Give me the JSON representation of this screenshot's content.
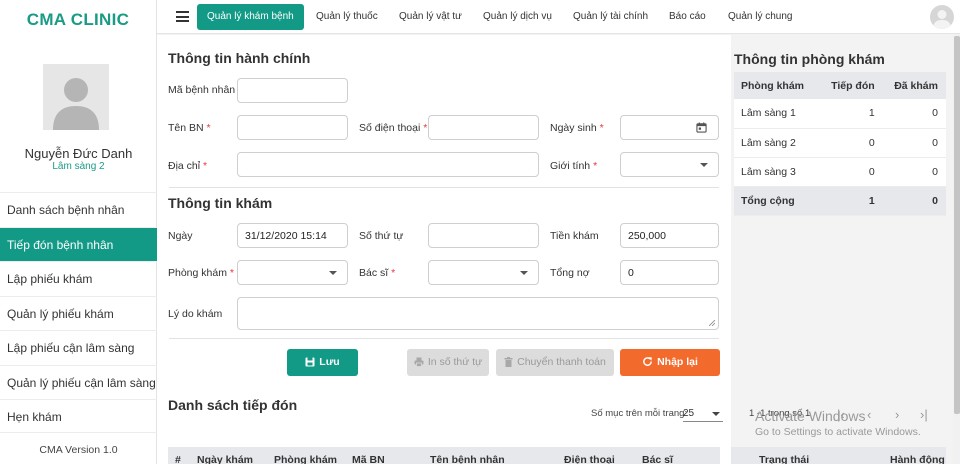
{
  "sidebar": {
    "brand": "CMA CLINIC",
    "user_name": "Nguyễn Đức Danh",
    "user_room": "Lâm sàng 2",
    "items": [
      {
        "label": "Danh sách bệnh nhân"
      },
      {
        "label": "Tiếp đón bệnh nhân"
      },
      {
        "label": "Lập phiếu khám"
      },
      {
        "label": "Quản lý phiếu khám"
      },
      {
        "label": "Lập phiếu cận lâm sàng"
      },
      {
        "label": "Quản lý phiếu cận lâm sàng"
      },
      {
        "label": "Hẹn khám"
      }
    ],
    "version": "CMA Version 1.0"
  },
  "topnav": {
    "tabs": [
      {
        "label": "Quản lý khám bệnh"
      },
      {
        "label": "Quản lý thuốc"
      },
      {
        "label": "Quản lý vật tư"
      },
      {
        "label": "Quản lý dịch vụ"
      },
      {
        "label": "Quản lý tài chính"
      },
      {
        "label": "Báo cáo"
      },
      {
        "label": "Quản lý chung"
      }
    ]
  },
  "admin_section": {
    "title": "Thông tin hành chính",
    "patient_id_label": "Mã bệnh nhân",
    "patient_id_value": "",
    "name_label": "Tên BN",
    "name_value": "",
    "phone_label": "Số điện thoại",
    "phone_value": "",
    "dob_label": "Ngày sinh",
    "dob_value": "",
    "address_label": "Địa chỉ",
    "address_value": "",
    "gender_label": "Giới tính",
    "gender_value": "",
    "required_mark": "*"
  },
  "exam_section": {
    "title": "Thông tin khám",
    "date_label": "Ngày",
    "date_value": "31/12/2020 15:14",
    "queue_label": "Số thứ tự",
    "queue_value": "",
    "fee_label": "Tiền khám",
    "fee_value": "250,000",
    "room_label": "Phòng khám",
    "room_value": "",
    "doctor_label": "Bác sĩ",
    "doctor_value": "",
    "debt_label": "Tổng nợ",
    "debt_value": "0",
    "reason_label": "Lý do khám",
    "reason_value": ""
  },
  "buttons": {
    "save": "Lưu",
    "print_queue": "In số thứ tự",
    "transfer_payment": "Chuyển thanh toán",
    "reset": "Nhập lại"
  },
  "reception_list": {
    "title": "Danh sách tiếp đón",
    "rows_per_page_label": "Số mục trên mỗi trang:",
    "rows_per_page_value": "25",
    "range_text": "1 -1 trong số 1",
    "columns": [
      "#",
      "Ngày khám",
      "Phòng khám",
      "Mã BN",
      "Tên bệnh nhân",
      "Điện thoại",
      "Bác sĩ",
      "Trạng thái",
      "Hành động"
    ]
  },
  "room_info": {
    "title": "Thông tin phòng khám",
    "columns": [
      "Phòng khám",
      "Tiếp đón",
      "Đã khám"
    ],
    "rows": [
      {
        "room": "Lâm sàng 1",
        "received": "1",
        "examined": "0"
      },
      {
        "room": "Lâm sàng 2",
        "received": "0",
        "examined": "0"
      },
      {
        "room": "Lâm sàng 3",
        "received": "0",
        "examined": "0"
      }
    ],
    "total": {
      "room": "Tổng cộng",
      "received": "1",
      "examined": "0"
    }
  },
  "watermark": {
    "line1": "Activate Windows",
    "line2": "Go to Settings to activate Windows."
  },
  "colors": {
    "primary": "#129a87",
    "brand": "#1a9b86",
    "danger": "#f26a2c",
    "disabled": "#dcdcdc",
    "header_bg": "#e6e8ec"
  }
}
